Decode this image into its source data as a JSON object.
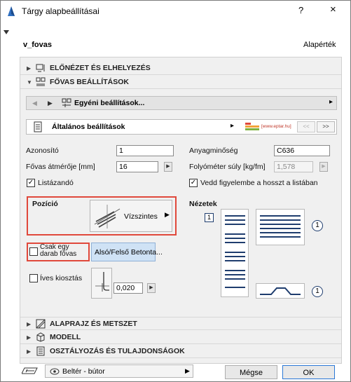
{
  "window": {
    "title": "Tárgy alapbeállításai",
    "help_glyph": "?",
    "close_glyph": "×"
  },
  "header": {
    "name": "v_fovas",
    "default_label": "Alapérték"
  },
  "sections": {
    "preview": "ELŐNÉZET ÉS ELHELYEZÉS",
    "rebar": "FŐVAS BEÁLLÍTÁSOK",
    "floorplan": "ALAPRAJZ ÉS METSZET",
    "model": "MODELL",
    "classification": "OSZTÁLYOZÁS ÉS TULAJDONSÁGOK"
  },
  "navbar": {
    "prev_glyph": "◀",
    "next_glyph": "▶",
    "label": "Egyéni beállítások...",
    "arrow_glyph": "▸"
  },
  "subbar": {
    "label": "Általános beállítások",
    "arrow_glyph": "▸",
    "logo_text": "[www.eptar.hu]",
    "prev_label": "<<",
    "next_label": ">>"
  },
  "form": {
    "id_label": "Azonosító",
    "id_value": "1",
    "material_label": "Anyagminőség",
    "material_value": "C636",
    "diameter_label": "Fővas átmérője [mm]",
    "diameter_value": "16",
    "weight_label": "Folyóméter súly [kg/fm]",
    "weight_value": "1,578",
    "listable_label": "Listázandó",
    "listable_checked": true,
    "length_label": "Vedd figyelembe a hosszt a listában",
    "length_checked": true,
    "position_label": "Pozíció",
    "position_value": "Vízszintes",
    "single_bar_label": "Csak egy darab fővas",
    "single_bar_checked": false,
    "concrete_button": "Alsó/Felső Betonta...",
    "curved_label": "Íves kiosztás",
    "curved_checked": false,
    "curved_value": "0,020",
    "views_label": "Nézetek",
    "view_count_1": "1",
    "view_count_2": "1",
    "view_count_3": "1"
  },
  "footer": {
    "layer_label": "Beltér - bútor",
    "cancel_label": "Mégse",
    "ok_label": "OK"
  },
  "colors": {
    "accent": "#2b78d6",
    "highlight_red": "#e0483b",
    "view_blue": "#1f3d6e"
  }
}
